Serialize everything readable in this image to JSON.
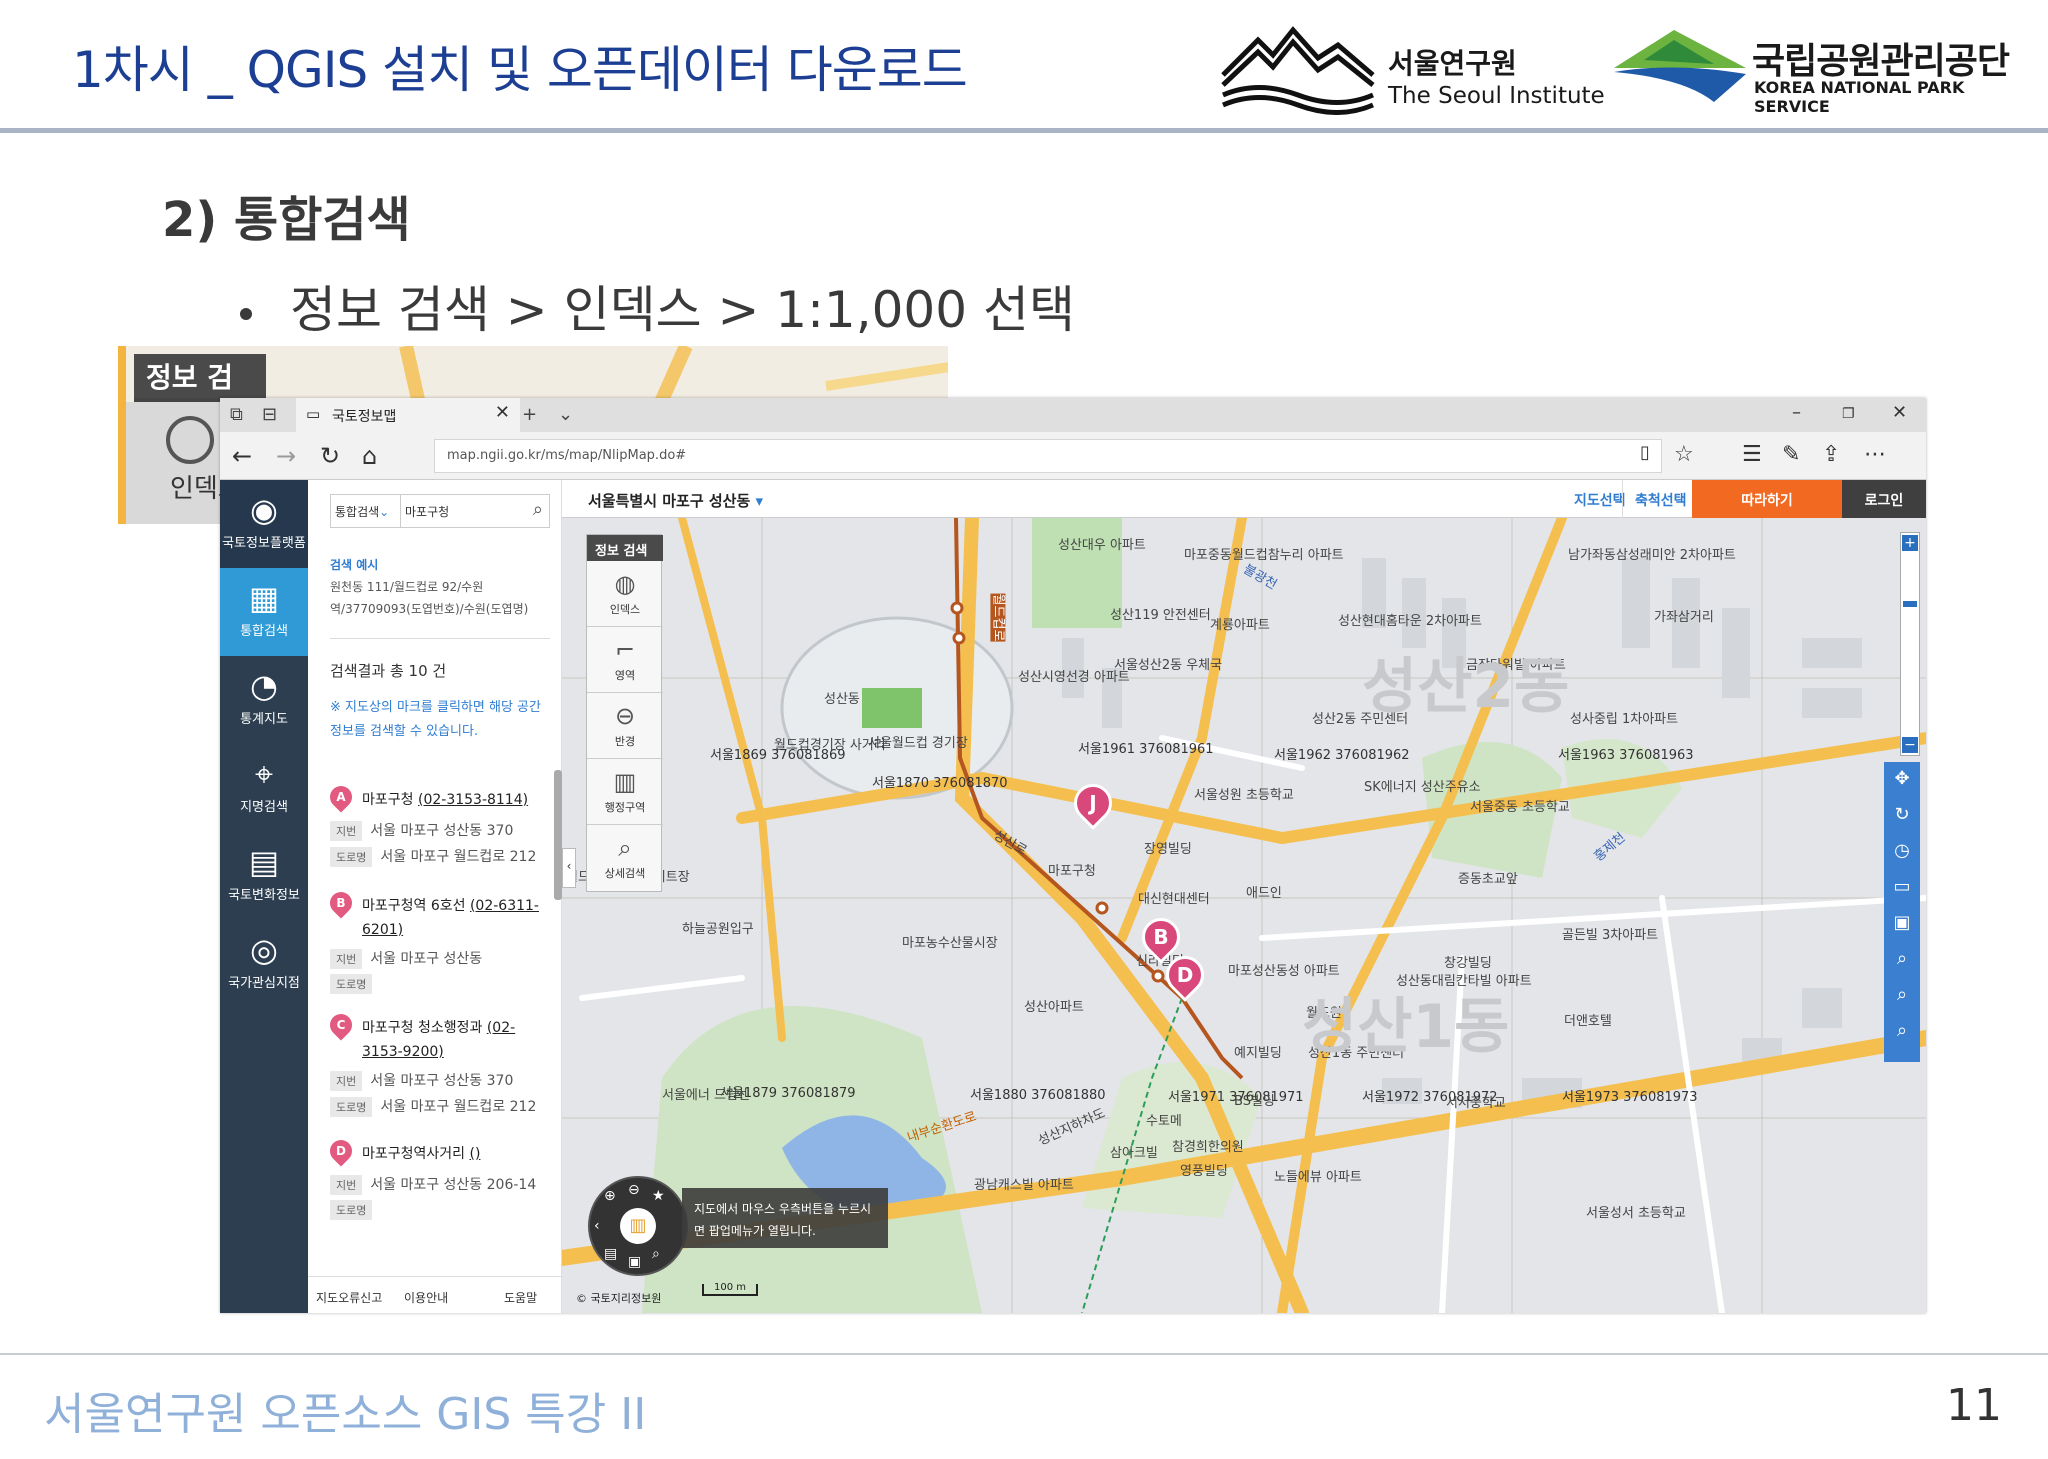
{
  "header": {
    "title": "1차시 _ QGIS 설치 및 오픈데이터 다운로드",
    "logo_seoul_ko": "서울연구원",
    "logo_seoul_en": "The Seoul Institute",
    "logo_knps_ko": "국립공원관리공단",
    "logo_knps_en": "KOREA NATIONAL PARK SERVICE"
  },
  "section_title": "2) 통합검색",
  "bullet": "정보 검색 > 인덱스 > 1:1,000 선택",
  "inset": {
    "tab": "정보 검색",
    "item": "인덱스"
  },
  "browser": {
    "tab_title": "국토정보맵",
    "url": "map.ngii.go.kr/ms/map/NlipMap.do#",
    "colors": {
      "sidebar": "#2c3e50",
      "active": "#2f9ad6",
      "accent_orange": "#f26a21",
      "marker": "#d9487a"
    }
  },
  "sidebar": {
    "items": [
      {
        "label": "국토정보플랫폼",
        "icon": "globe-icon"
      },
      {
        "label": "통합검색",
        "icon": "map-icon"
      },
      {
        "label": "통계지도",
        "icon": "pie-chart-icon"
      },
      {
        "label": "지명검색",
        "icon": "map-pin-icon"
      },
      {
        "label": "국토변화정보",
        "icon": "building-change-icon"
      },
      {
        "label": "국가관심지점",
        "icon": "target-icon"
      }
    ]
  },
  "search_panel": {
    "select": "통합검색",
    "query": "마포구청",
    "example_title": "검색 예시",
    "example_text": "원천동 111/월드컵로 92/수원역/37709093(도엽번호)/수원(도엽명)",
    "result_count": "검색결과 총 10 건",
    "note": "※ 지도상의 마크를 클릭하면 해당 공간정보를 검색할 수 있습니다.",
    "results": [
      {
        "marker": "A",
        "name": "마포구청 ",
        "phone": "(02-3153-8114)",
        "jibun": "서울 마포구 성산동 370",
        "road": "서울 마포구 월드컵로 212"
      },
      {
        "marker": "B",
        "name": "마포구청역 6호선 ",
        "phone": "(02-6311-6201)",
        "jibun": "서울 마포구 성산동",
        "road": ""
      },
      {
        "marker": "C",
        "name": "마포구청 청소행정과 ",
        "phone": "(02-3153-9200)",
        "jibun": "서울 마포구 성산동 370",
        "road": "서울 마포구 월드컵로 212"
      },
      {
        "marker": "D",
        "name": "마포구청역사거리 ",
        "phone": "()",
        "jibun": "서울 마포구 성산동 206-14",
        "road": ""
      }
    ],
    "tag_jibun": "지번",
    "tag_road": "도로명",
    "footer": [
      "지도오류신고",
      "이용안내",
      "도움말"
    ]
  },
  "map": {
    "location": "서울특별시 마포구 성산동",
    "buttons": [
      "지도선택",
      "축척선택",
      "따라하기",
      "로그인"
    ],
    "tool_header": "정보 검색",
    "tools": [
      {
        "label": "인덱스",
        "icon": "globe-icon"
      },
      {
        "label": "영역",
        "icon": "area-icon"
      },
      {
        "label": "반경",
        "icon": "radius-icon"
      },
      {
        "label": "행정구역",
        "icon": "book-map-icon"
      },
      {
        "label": "상세검색",
        "icon": "magnifier-icon"
      }
    ],
    "markers": [
      "J",
      "B",
      "D"
    ],
    "hint": "지도에서 마우스 우측버튼을 누르시면 팝업메뉴가 열립니다.",
    "copyright": "© 국토지리정보원",
    "scale": "100 m",
    "labels": [
      "성산대우 아파트",
      "마포중동월드컵참누리 아파트",
      "남가좌동삼성래미안 2차아파트",
      "성산119 안전센터",
      "계룡아파트",
      "성산현대홈타운 2차아파트",
      "가좌삼거리",
      "서울성산2동 우체국",
      "금장타워빌 아파트",
      "성산시영선경 아파트",
      "성산동",
      "서울월드컵 경기장",
      "월드컵경기장 사거리",
      "서울1869 376081869",
      "서울1870 376081870",
      "서울1961 376081961",
      "성산2동 주민센터",
      "서울1962 376081962",
      "성사중립 1차아파트",
      "서울1963 376081963",
      "SK에너지 성산주유소",
      "서울성원 초등학교",
      "서울중동 초등학교",
      "마포구청",
      "장영빌딩",
      "증동초교앞",
      "대신현대센터",
      "애드인",
      "하늘공원입구",
      "마포농수산물시장",
      "신라빌딩",
      "마포성산동성 아파트",
      "창강빌딩",
      "성산동대림칸타빌 아파트",
      "골든빌 3차아파트",
      "성산아파트",
      "월드원",
      "더앤호텔",
      "예지빌딩",
      "성산1동 주민센터",
      "서울1879 376081879",
      "서울1880 376081880",
      "서울1971 376081971",
      "서울1972 376081972",
      "서울1973 376081973",
      "BS빌딩",
      "서서중학교",
      "수토메",
      "참경희한의원",
      "영풍빌딩",
      "삼아크빌",
      "광남캐스빌 아파트",
      "노들에뷰 아파트",
      "서울성서 초등학교",
      "성산지하차도",
      "내부순환도로",
      "월드컵공원 스케이트장",
      "서울에너 드림센",
      "홍제천",
      "불광천",
      "월드컵로",
      "성산로",
      "성산2동",
      "성산1동"
    ]
  },
  "footer": {
    "text": "서울연구원 오픈소스 GIS 특강 II",
    "page": "11"
  }
}
